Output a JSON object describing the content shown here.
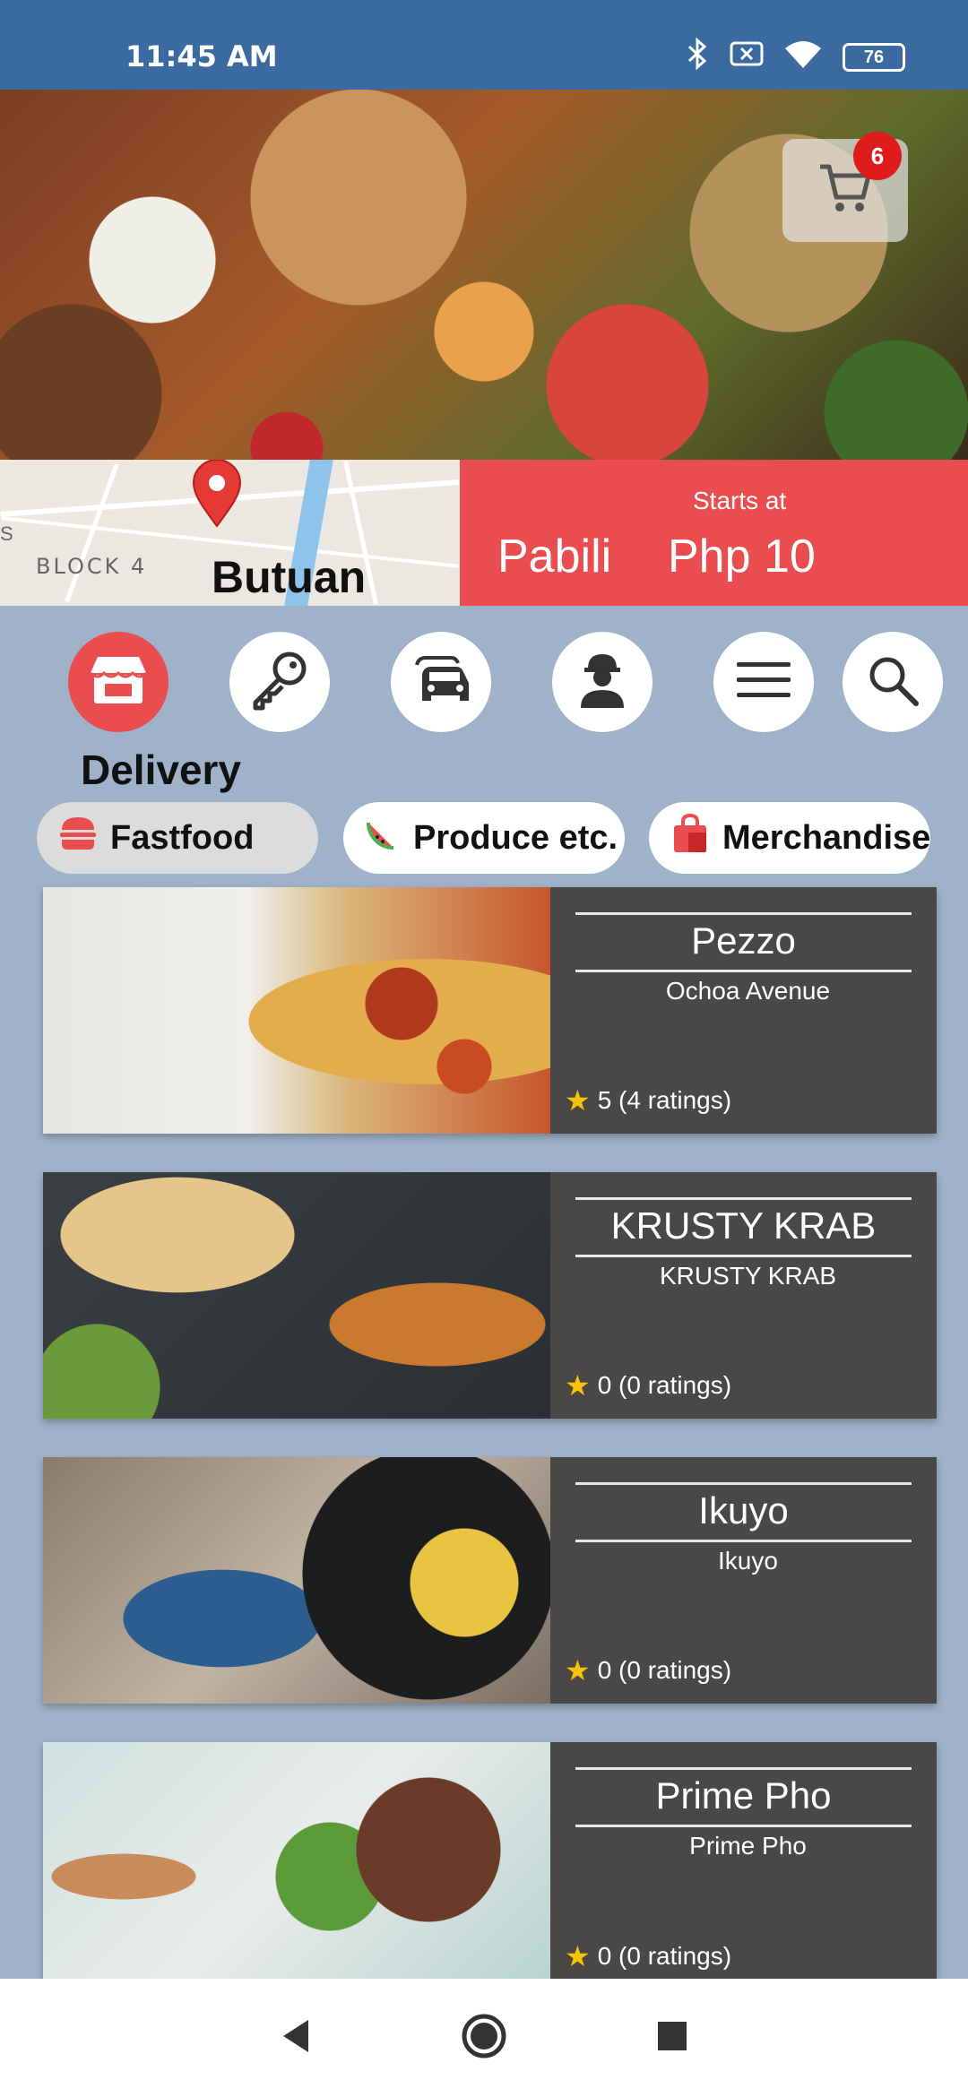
{
  "status_bar": {
    "time": "11:45 AM",
    "battery": "76",
    "icons": [
      "bluetooth-icon",
      "close-box-icon",
      "wifi-icon",
      "battery-icon"
    ]
  },
  "hero": {
    "cart_badge": "6"
  },
  "map": {
    "block_label": "BLOCK 4",
    "city": "Butuan",
    "edge_text": "S"
  },
  "promo": {
    "starts_at": "Starts at",
    "service": "Pabili",
    "price": "Php 10"
  },
  "categories": [
    {
      "icon": "store-icon",
      "active": true
    },
    {
      "icon": "key-icon",
      "active": false
    },
    {
      "icon": "car-icon",
      "active": false
    },
    {
      "icon": "worker-icon",
      "active": false
    },
    {
      "icon": "menu-icon",
      "active": false
    },
    {
      "icon": "search-icon",
      "active": false
    }
  ],
  "section_title": "Delivery",
  "filters": [
    {
      "label": "Fastfood",
      "icon": "burger-icon",
      "active": true
    },
    {
      "label": "Produce etc.",
      "icon": "watermelon-icon",
      "active": false
    },
    {
      "label": "Merchandise",
      "icon": "shopping-bag-icon",
      "active": false
    }
  ],
  "stores": [
    {
      "name": "Pezzo",
      "location": "Ochoa Avenue",
      "rating": "5 (4 ratings)"
    },
    {
      "name": "KRUSTY KRAB",
      "location": "KRUSTY KRAB",
      "rating": "0 (0 ratings)"
    },
    {
      "name": "Ikuyo",
      "location": "Ikuyo",
      "rating": "0 (0 ratings)"
    },
    {
      "name": "Prime Pho",
      "location": "Prime Pho",
      "rating": "0 (0 ratings)"
    }
  ],
  "colors": {
    "status_bar": "#3a6aa0",
    "accent": "#e94d4f",
    "background": "#9fb2c9",
    "card_info": "#4a4747",
    "star": "#f6c400"
  }
}
